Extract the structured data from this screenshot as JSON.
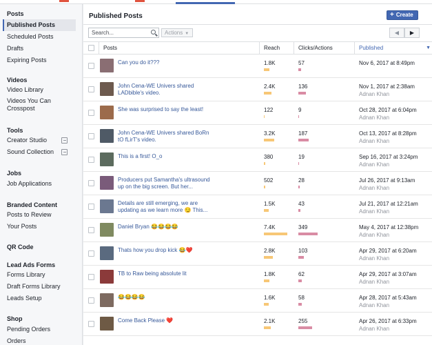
{
  "sidebar": {
    "sections": [
      {
        "header": "Posts",
        "items": [
          "Published Posts",
          "Scheduled Posts",
          "Drafts",
          "Expiring Posts"
        ]
      },
      {
        "header": "Videos",
        "items": [
          "Video Library",
          "Videos You Can Crosspost"
        ]
      },
      {
        "header": "Tools",
        "items": [
          "Creator Studio",
          "Sound Collection"
        ]
      },
      {
        "header": "Jobs",
        "items": [
          "Job Applications"
        ]
      },
      {
        "header": "Branded Content",
        "items": [
          "Posts to Review",
          "Your Posts"
        ]
      },
      {
        "header": "QR Code",
        "items": []
      },
      {
        "header": "Lead Ads Forms",
        "items": [
          "Forms Library",
          "Draft Forms Library",
          "Leads Setup"
        ]
      },
      {
        "header": "Shop",
        "items": [
          "Pending Orders",
          "Orders"
        ]
      }
    ],
    "active_item": "Published Posts"
  },
  "main": {
    "title": "Published Posts",
    "create_label": "Create",
    "search_placeholder": "Search...",
    "actions_label": "Actions",
    "columns": {
      "posts": "Posts",
      "reach": "Reach",
      "clicks": "Clicks/Actions",
      "published": "Published"
    }
  },
  "rows": [
    {
      "text": "Can you do it???",
      "reach": "1.8K",
      "clicks": "57",
      "date": "Nov 6, 2017 at 8:49pm",
      "author": ""
    },
    {
      "text": "John Cena-WE Univers shared LADbible's video.",
      "reach": "2.4K",
      "clicks": "136",
      "date": "Nov 1, 2017 at 2:38am",
      "author": "Adnan Khan"
    },
    {
      "text": "She was surprised to say the least!",
      "reach": "122",
      "clicks": "9",
      "date": "Oct 28, 2017 at 6:04pm",
      "author": "Adnan Khan"
    },
    {
      "text": "John Cena-WE Univers shared BoRn tO fLirT's video.",
      "reach": "3.2K",
      "clicks": "187",
      "date": "Oct 13, 2017 at 8:28pm",
      "author": "Adnan Khan"
    },
    {
      "text": "This is a first! O_o",
      "reach": "380",
      "clicks": "19",
      "date": "Sep 16, 2017 at 3:24pm",
      "author": "Adnan Khan"
    },
    {
      "text": "Producers put Samantha's ultrasound up on the big screen. But her...",
      "reach": "502",
      "clicks": "28",
      "date": "Jul 26, 2017 at 9:13am",
      "author": "Adnan Khan"
    },
    {
      "text": "Details are still emerging, we are updating as we learn more 😏 This...",
      "reach": "1.5K",
      "clicks": "43",
      "date": "Jul 21, 2017 at 12:21am",
      "author": "Adnan Khan"
    },
    {
      "text": "Daniel Bryan 😂😂😂😂",
      "reach": "7.4K",
      "clicks": "349",
      "date": "May 4, 2017 at 12:38pm",
      "author": "Adnan Khan"
    },
    {
      "text": "Thats how you drop kick 😂❤️",
      "reach": "2.8K",
      "clicks": "103",
      "date": "Apr 29, 2017 at 6:20am",
      "author": "Adnan Khan"
    },
    {
      "text": "TB to Raw being absolute lit",
      "reach": "1.8K",
      "clicks": "62",
      "date": "Apr 29, 2017 at 3:07am",
      "author": "Adnan Khan"
    },
    {
      "text": "😂😂😂😂",
      "reach": "1.6K",
      "clicks": "58",
      "date": "Apr 28, 2017 at 5:43am",
      "author": "Adnan Khan"
    },
    {
      "text": "Come Back Please ❤️",
      "reach": "2.1K",
      "clicks": "255",
      "date": "Apr 26, 2017 at 6:33pm",
      "author": "Adnan Khan"
    }
  ],
  "bars": {
    "reach_fraction": [
      0.24,
      0.32,
      0.02,
      0.43,
      0.05,
      0.07,
      0.2,
      1.0,
      0.38,
      0.24,
      0.22,
      0.28
    ],
    "clicks_fraction": [
      0.16,
      0.39,
      0.03,
      0.54,
      0.05,
      0.08,
      0.12,
      1.0,
      0.3,
      0.18,
      0.17,
      0.73
    ]
  },
  "colors": {
    "accent": "#4267b2",
    "link": "#365899",
    "reach_bar": "#f7c776",
    "clicks_bar": "#d98ca4"
  }
}
